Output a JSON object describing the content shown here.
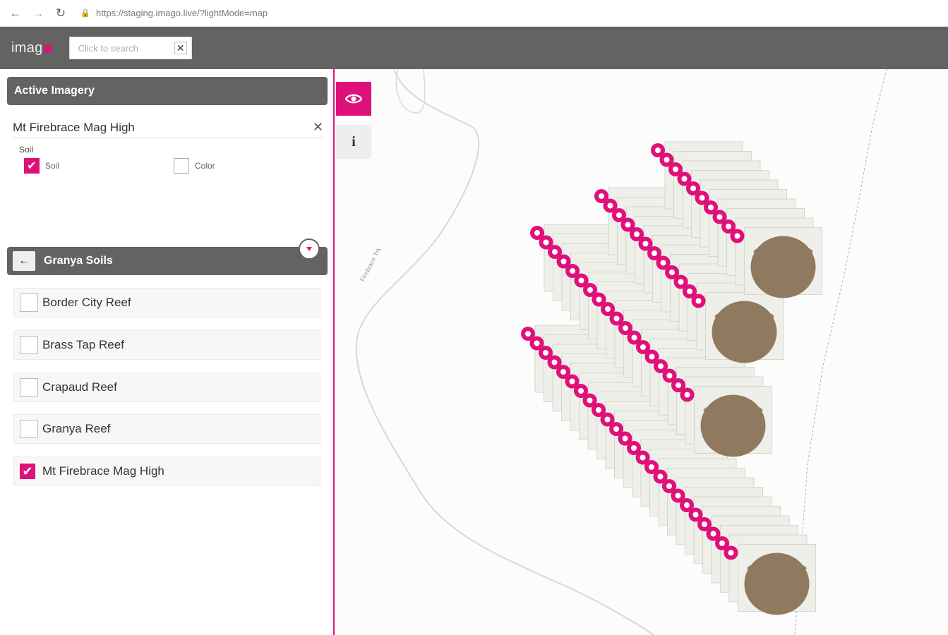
{
  "browser": {
    "url": "https://staging.imago.live/?lightMode=map"
  },
  "header": {
    "logo_text": "imag",
    "search_placeholder": "Click to search"
  },
  "active_imagery": {
    "title": "Active Imagery",
    "layer_name": "Mt Firebrace Mag High",
    "group_label": "Soil",
    "options": [
      {
        "label": "Soil",
        "checked": true
      },
      {
        "label": "Color",
        "checked": false
      }
    ]
  },
  "granya": {
    "title": "Granya Soils",
    "items": [
      {
        "label": "Border City Reef",
        "checked": false
      },
      {
        "label": "Brass Tap Reef",
        "checked": false
      },
      {
        "label": "Crapaud Reef",
        "checked": false
      },
      {
        "label": "Granya Reef",
        "checked": false
      },
      {
        "label": "Mt Firebrace Mag High",
        "checked": true
      }
    ]
  },
  "map": {
    "road_label": "Firebrace Trk",
    "accent": "#e0107a"
  }
}
